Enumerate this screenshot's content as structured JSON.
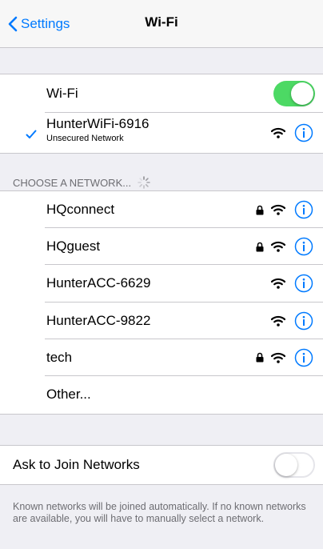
{
  "navbar": {
    "back_label": "Settings",
    "title": "Wi-Fi"
  },
  "wifi_toggle": {
    "label": "Wi-Fi",
    "on": true,
    "on_color": "#4cd964"
  },
  "connected": {
    "name": "HunterWiFi-6916",
    "subtitle": "Unsecured Network",
    "checkmark_color": "#007aff"
  },
  "section_header": "CHOOSE A NETWORK...",
  "networks": [
    {
      "name": "HQconnect",
      "locked": true
    },
    {
      "name": "HQguest",
      "locked": true
    },
    {
      "name": "HunterACC-6629",
      "locked": false
    },
    {
      "name": "HunterACC-9822",
      "locked": false
    },
    {
      "name": "tech",
      "locked": true
    }
  ],
  "other_label": "Other...",
  "ask_to_join": {
    "label": "Ask to Join Networks",
    "on": false
  },
  "footer_note": "Known networks will be joined automatically. If no known networks are available, you will have to manually select a network.",
  "accent_color": "#007aff"
}
